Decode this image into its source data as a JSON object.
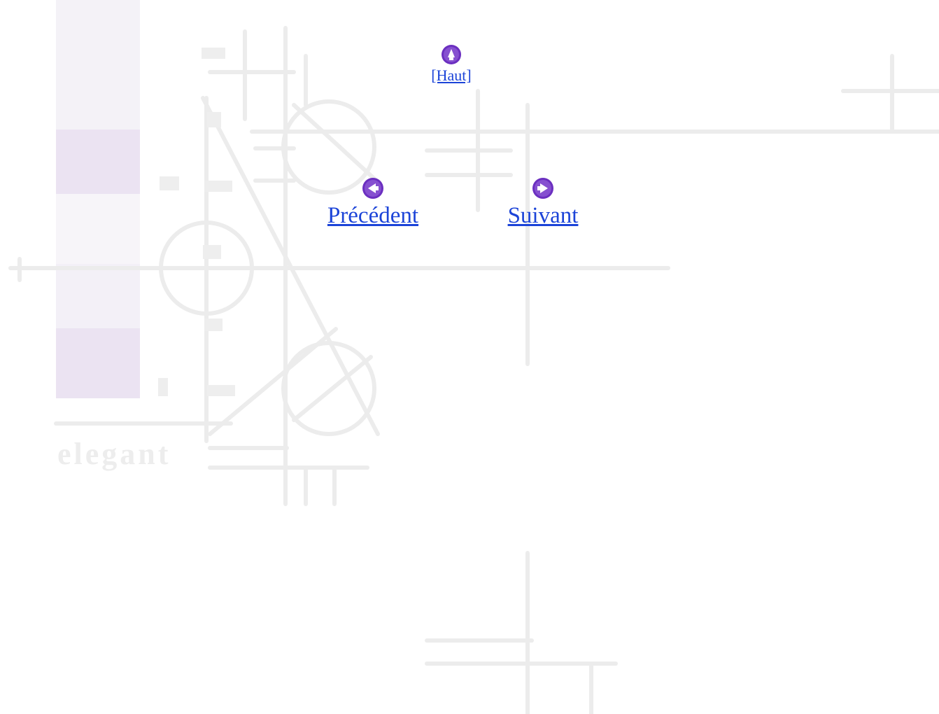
{
  "navigation": {
    "top": {
      "label": "[Haut]",
      "icon": "up-arrow-icon"
    },
    "previous": {
      "label": "Précédent",
      "icon": "left-arrow-icon"
    },
    "next": {
      "label": "Suivant",
      "icon": "right-arrow-icon"
    }
  },
  "colors": {
    "link": "#1c44d8",
    "icon_fill": "#6b2fc0",
    "icon_light": "#9a6ad8",
    "watermark_line": "#ececec",
    "watermark_block": "#ece4f2"
  },
  "background": {
    "watermark_text": "elegant"
  }
}
